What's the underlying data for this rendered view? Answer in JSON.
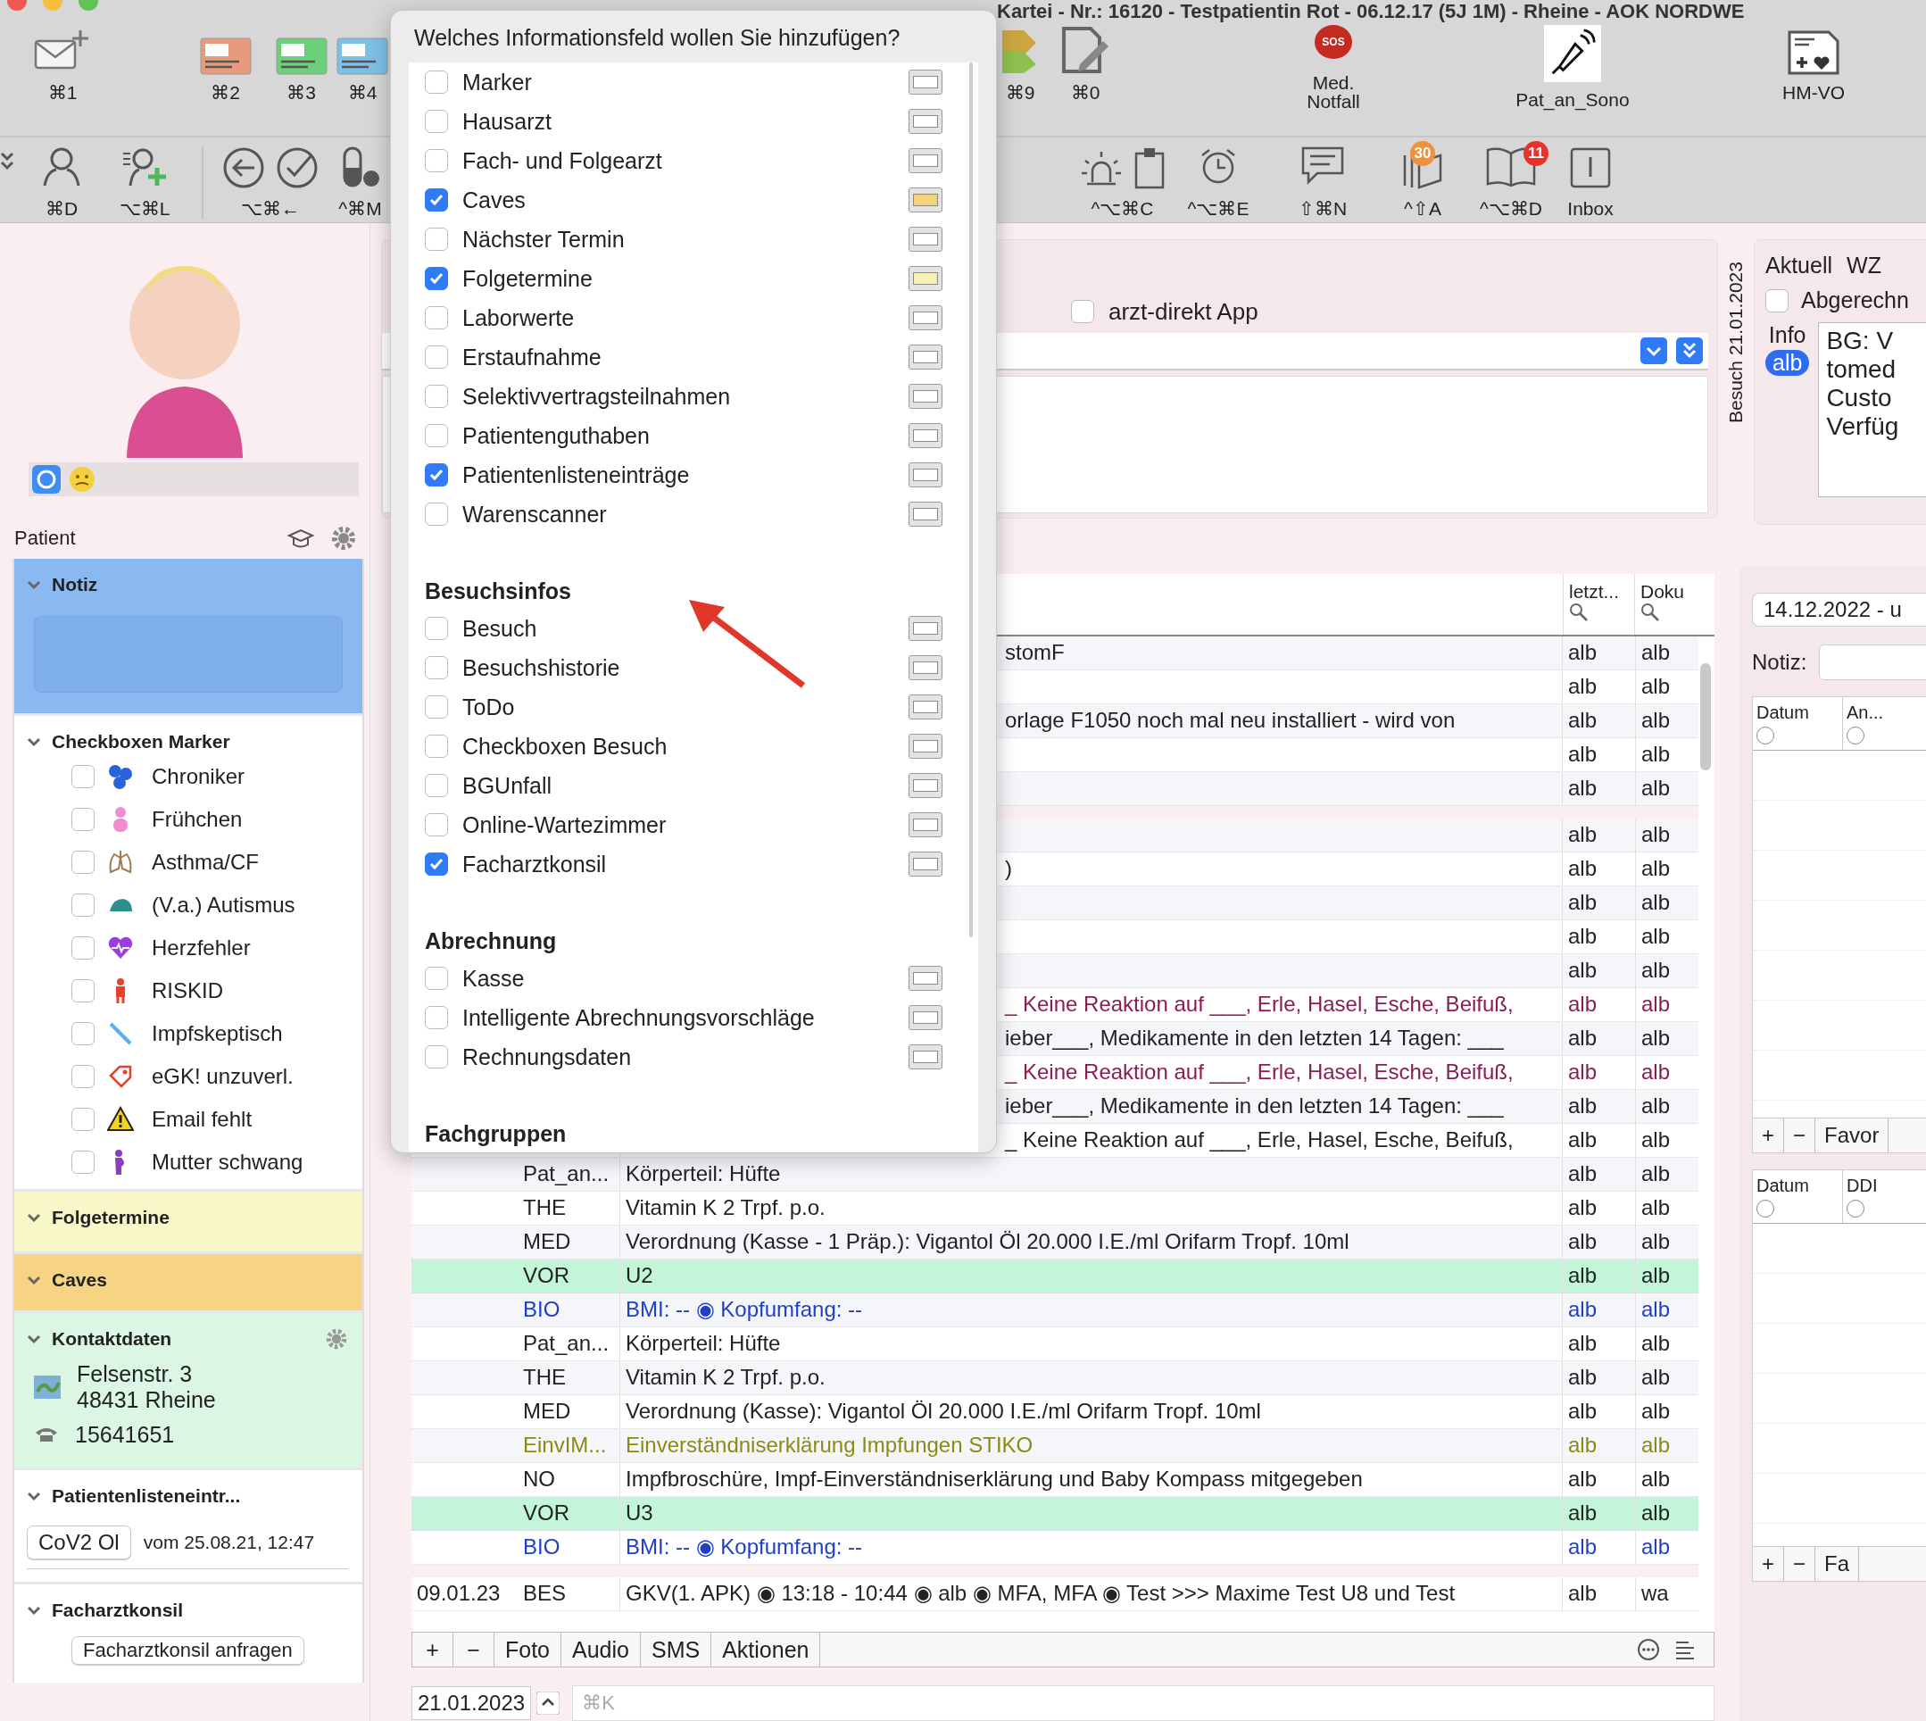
{
  "window": {
    "title": "Kartei - Nr.: 16120 - Testpatientin Rot - 06.12.17 (5J 1M) - Rheine - AOK NORDWE"
  },
  "toolbar": {
    "top_left": [
      {
        "label": "⌘1"
      },
      {
        "label": "⌘2"
      },
      {
        "label": "⌘3"
      },
      {
        "label": "⌘4"
      }
    ],
    "top_right": [
      {
        "label": "⌘9"
      },
      {
        "label": "⌘0"
      },
      {
        "label": "Med. Notfall",
        "badge": "SOS"
      },
      {
        "label": "Pat_an_Sono"
      },
      {
        "label": "HM-VO"
      }
    ],
    "bottom_left": [
      {
        "label": "⌘D"
      },
      {
        "label": "⌥⌘L"
      },
      {
        "label": "⌥⌘←"
      },
      {
        "label": "^⌘M"
      }
    ],
    "bottom_right": [
      {
        "label": "^⌥⌘C"
      },
      {
        "label": "^⌥⌘E"
      },
      {
        "label": "⇧⌘N"
      },
      {
        "label": "^⇧A",
        "badge": "30"
      },
      {
        "label": "^⌥⌘D",
        "badge": "11"
      },
      {
        "label": "Inbox"
      }
    ]
  },
  "sidebar": {
    "label": "Patient",
    "notiz": {
      "title": "Notiz"
    },
    "markers": {
      "title": "Checkboxen Marker",
      "items": [
        {
          "label": "Chroniker",
          "checked": false
        },
        {
          "label": "Frühchen",
          "checked": false
        },
        {
          "label": "Asthma/CF",
          "checked": false
        },
        {
          "label": "(V.a.) Autismus",
          "checked": false
        },
        {
          "label": "Herzfehler",
          "checked": false
        },
        {
          "label": "RISKID",
          "checked": false
        },
        {
          "label": "Impfskeptisch",
          "checked": false
        },
        {
          "label": "eGK! unzuverl.",
          "checked": false
        },
        {
          "label": "Email fehlt",
          "checked": false
        },
        {
          "label": "Mutter schwang",
          "checked": false
        }
      ]
    },
    "folgetermine": {
      "title": "Folgetermine"
    },
    "caves": {
      "title": "Caves"
    },
    "kontakt": {
      "title": "Kontaktdaten",
      "street": "Felsenstr. 3",
      "city": "48431  Rheine",
      "phone": "15641651"
    },
    "liste": {
      "title": "Patientenlisteneintr...",
      "entry": "CoV2 Ol",
      "date": "vom 25.08.21, 12:47"
    },
    "konsil": {
      "title": "Facharztkonsil",
      "button": "Facharztkonsil anfragen"
    }
  },
  "visit_panel": {
    "app_checkbox": {
      "label": "arzt-direkt App",
      "checked": false
    }
  },
  "table": {
    "columns": [
      "letzt...",
      "Doku"
    ],
    "rows": [
      {
        "kind": "plain",
        "covered": true,
        "date": "",
        "type": "",
        "text": "stomF",
        "last": "alb",
        "doku": "alb"
      },
      {
        "kind": "plain",
        "date": "",
        "type": "",
        "text": "",
        "last": "alb",
        "doku": "alb"
      },
      {
        "kind": "plain",
        "covered": true,
        "date": "",
        "type": "",
        "text": "orlage F1050 noch mal neu installiert  - wird von",
        "last": "alb",
        "doku": "alb"
      },
      {
        "kind": "plain",
        "date": "",
        "type": "",
        "text": "",
        "last": "alb",
        "doku": "alb"
      },
      {
        "kind": "plain",
        "date": "",
        "type": "",
        "text": "",
        "last": "alb",
        "doku": "alb"
      },
      {
        "kind": "separator"
      },
      {
        "kind": "plain",
        "date": "",
        "type": "",
        "text": "",
        "last": "alb",
        "doku": "alb"
      },
      {
        "kind": "plain",
        "covered": true,
        "date": "",
        "type": "",
        "text": ")",
        "last": "alb",
        "doku": "alb"
      },
      {
        "kind": "plain",
        "date": "",
        "type": "",
        "text": "",
        "last": "alb",
        "doku": "alb"
      },
      {
        "kind": "plain",
        "date": "",
        "type": "",
        "text": "",
        "last": "alb",
        "doku": "alb"
      },
      {
        "kind": "plain",
        "date": "",
        "type": "",
        "text": "",
        "last": "alb",
        "doku": "alb"
      },
      {
        "kind": "allergy",
        "covered": true,
        "date": "",
        "type": "",
        "text": "_ Keine Reaktion auf ___, Erle, Hasel, Esche, Beifuß,",
        "last": "alb",
        "doku": "alb"
      },
      {
        "kind": "plain",
        "covered": true,
        "date": "",
        "type": "",
        "text": "ieber___, Medikamente in den letzten 14 Tagen: ___",
        "last": "alb",
        "doku": "alb"
      },
      {
        "kind": "allergy",
        "covered": true,
        "date": "",
        "type": "",
        "text": "_ Keine Reaktion auf ___, Erle, Hasel, Esche, Beifuß,",
        "last": "alb",
        "doku": "alb"
      },
      {
        "kind": "plain",
        "covered": true,
        "date": "",
        "type": "",
        "text": "ieber___, Medikamente in den letzten 14 Tagen: ___",
        "last": "alb",
        "doku": "alb"
      },
      {
        "kind": "plain",
        "covered": true,
        "date": "",
        "type": "",
        "text": "_ Keine Reaktion auf ___, Erle, Hasel, Esche, Beifuß,",
        "last": "alb",
        "doku": "alb"
      },
      {
        "kind": "plain",
        "covered": false,
        "date": "",
        "type": "Pat_an...",
        "text": "Körperteil: Hüfte",
        "last": "alb",
        "doku": "alb"
      },
      {
        "kind": "plain",
        "covered": false,
        "date": "",
        "type": "THE",
        "text": "Vitamin K 2 Trpf. p.o.",
        "last": "alb",
        "doku": "alb"
      },
      {
        "kind": "plain",
        "covered": false,
        "date": "",
        "type": "MED",
        "text": "Verordnung (Kasse - 1 Präp.): Vigantol Öl 20.000 I.E./ml Orifarm Tropf. 10ml",
        "last": "alb",
        "doku": "alb"
      },
      {
        "kind": "vorsorge",
        "covered": false,
        "date": "",
        "type": "VOR",
        "text": "U2",
        "last": "alb",
        "doku": "alb"
      },
      {
        "kind": "bio",
        "covered": false,
        "date": "",
        "type": "BIO",
        "text": "BMI: -- ◉ Kopfumfang: --",
        "last": "alb",
        "doku": "alb"
      },
      {
        "kind": "plain",
        "covered": false,
        "date": "",
        "type": "Pat_an...",
        "text": "Körperteil: Hüfte",
        "last": "alb",
        "doku": "alb"
      },
      {
        "kind": "plain",
        "covered": false,
        "date": "",
        "type": "THE",
        "text": "Vitamin K 2 Trpf. p.o.",
        "last": "alb",
        "doku": "alb"
      },
      {
        "kind": "plain",
        "covered": false,
        "date": "",
        "type": "MED",
        "text": "Verordnung (Kasse): Vigantol Öl 20.000 I.E./ml Orifarm Tropf. 10ml",
        "last": "alb",
        "doku": "alb"
      },
      {
        "kind": "consent",
        "covered": false,
        "date": "",
        "type": "EinvIM...",
        "text": "Einverständniserklärung Impfungen STIKO",
        "last": "alb",
        "doku": "alb"
      },
      {
        "kind": "plain",
        "covered": false,
        "date": "",
        "type": "NO",
        "text": "Impfbroschüre, Impf-Einverständniserklärung und Baby Kompass mitgegeben",
        "last": "alb",
        "doku": "alb"
      },
      {
        "kind": "vorsorge",
        "covered": false,
        "date": "",
        "type": "VOR",
        "text": "U3",
        "last": "alb",
        "doku": "alb"
      },
      {
        "kind": "bio",
        "covered": false,
        "date": "",
        "type": "BIO",
        "text": "BMI: -- ◉ Kopfumfang: --",
        "last": "alb",
        "doku": "alb"
      },
      {
        "kind": "separator"
      },
      {
        "kind": "plain",
        "covered": false,
        "date": "09.01.23",
        "type": "BES",
        "text": "GKV(1. APK) ◉ 13:18 - 10:44 ◉ alb ◉ MFA, MFA ◉ Test >>>   Maxime Test U8 und Test",
        "last": "alb",
        "doku": "wa"
      }
    ]
  },
  "table_toolbar": {
    "buttons": [
      "+",
      "−",
      "Foto",
      "Audio",
      "SMS",
      "Aktionen"
    ]
  },
  "entry_bar": {
    "date": "21.01.2023",
    "placeholder": "⌘K"
  },
  "visit_info": {
    "label": "Besuch 21.01.2023",
    "headings": [
      "Aktuell",
      "WZ"
    ],
    "billed": {
      "label": "Abgerechn",
      "checked": false
    },
    "info_label": "Info",
    "user": "alb",
    "notes": [
      "BG: V",
      "tomed",
      "Custo",
      "Verfüg"
    ]
  },
  "side_lists": {
    "period": "14.12.2022 - u",
    "note_label": "Notiz:",
    "tables": [
      {
        "columns": [
          {
            "label": "Datum",
            "selected": false
          },
          {
            "label": "An...",
            "selected": false
          }
        ],
        "footer": [
          "+",
          "−",
          "Favor"
        ]
      },
      {
        "columns": [
          {
            "label": "Datum",
            "selected": false
          },
          {
            "label": "DDI",
            "selected": false
          }
        ],
        "footer": [
          "+",
          "−",
          "Fa"
        ]
      }
    ]
  },
  "dialog": {
    "title": "Welches Informationsfeld wollen Sie hinzufügen?",
    "groups": [
      {
        "items": [
          {
            "label": "Marker",
            "checked": false,
            "color": "#ffffff"
          },
          {
            "label": "Hausarzt",
            "checked": false,
            "color": "#ffffff"
          },
          {
            "label": "Fach- und Folgearzt",
            "checked": false,
            "color": "#ffffff"
          },
          {
            "label": "Caves",
            "checked": true,
            "color": "#f5d27e"
          },
          {
            "label": "Nächster Termin",
            "checked": false,
            "color": "#ffffff"
          },
          {
            "label": "Folgetermine",
            "checked": true,
            "color": "#f7f0b4"
          },
          {
            "label": "Laborwerte",
            "checked": false,
            "color": "#ffffff"
          },
          {
            "label": "Erstaufnahme",
            "checked": false,
            "color": "#ffffff"
          },
          {
            "label": "Selektivvertragsteilnahmen",
            "checked": false,
            "color": "#ffffff"
          },
          {
            "label": "Patientenguthaben",
            "checked": false,
            "color": "#ffffff"
          },
          {
            "label": "Patientenlisteneinträge",
            "checked": true,
            "color": "#ffffff"
          },
          {
            "label": "Warenscanner",
            "checked": false,
            "color": "#ffffff"
          }
        ]
      },
      {
        "heading": "Besuchsinfos",
        "items": [
          {
            "label": "Besuch",
            "checked": false,
            "color": "#ffffff"
          },
          {
            "label": "Besuchshistorie",
            "checked": false,
            "color": "#ffffff"
          },
          {
            "label": "ToDo",
            "checked": false,
            "color": "#ffffff"
          },
          {
            "label": "Checkboxen Besuch",
            "checked": false,
            "color": "#ffffff"
          },
          {
            "label": "BGUnfall",
            "checked": false,
            "color": "#ffffff"
          },
          {
            "label": "Online-Wartezimmer",
            "checked": false,
            "color": "#ffffff"
          },
          {
            "label": "Facharztkonsil",
            "checked": true,
            "color": "#ffffff"
          }
        ]
      },
      {
        "heading": "Abrechnung",
        "items": [
          {
            "label": "Kasse",
            "checked": false,
            "color": "#ffffff"
          },
          {
            "label": "Intelligente Abrechnungsvorschläge",
            "checked": false,
            "color": "#ffffff"
          },
          {
            "label": "Rechnungsdaten",
            "checked": false,
            "color": "#ffffff"
          }
        ]
      },
      {
        "heading": "Fachgruppen"
      }
    ]
  }
}
